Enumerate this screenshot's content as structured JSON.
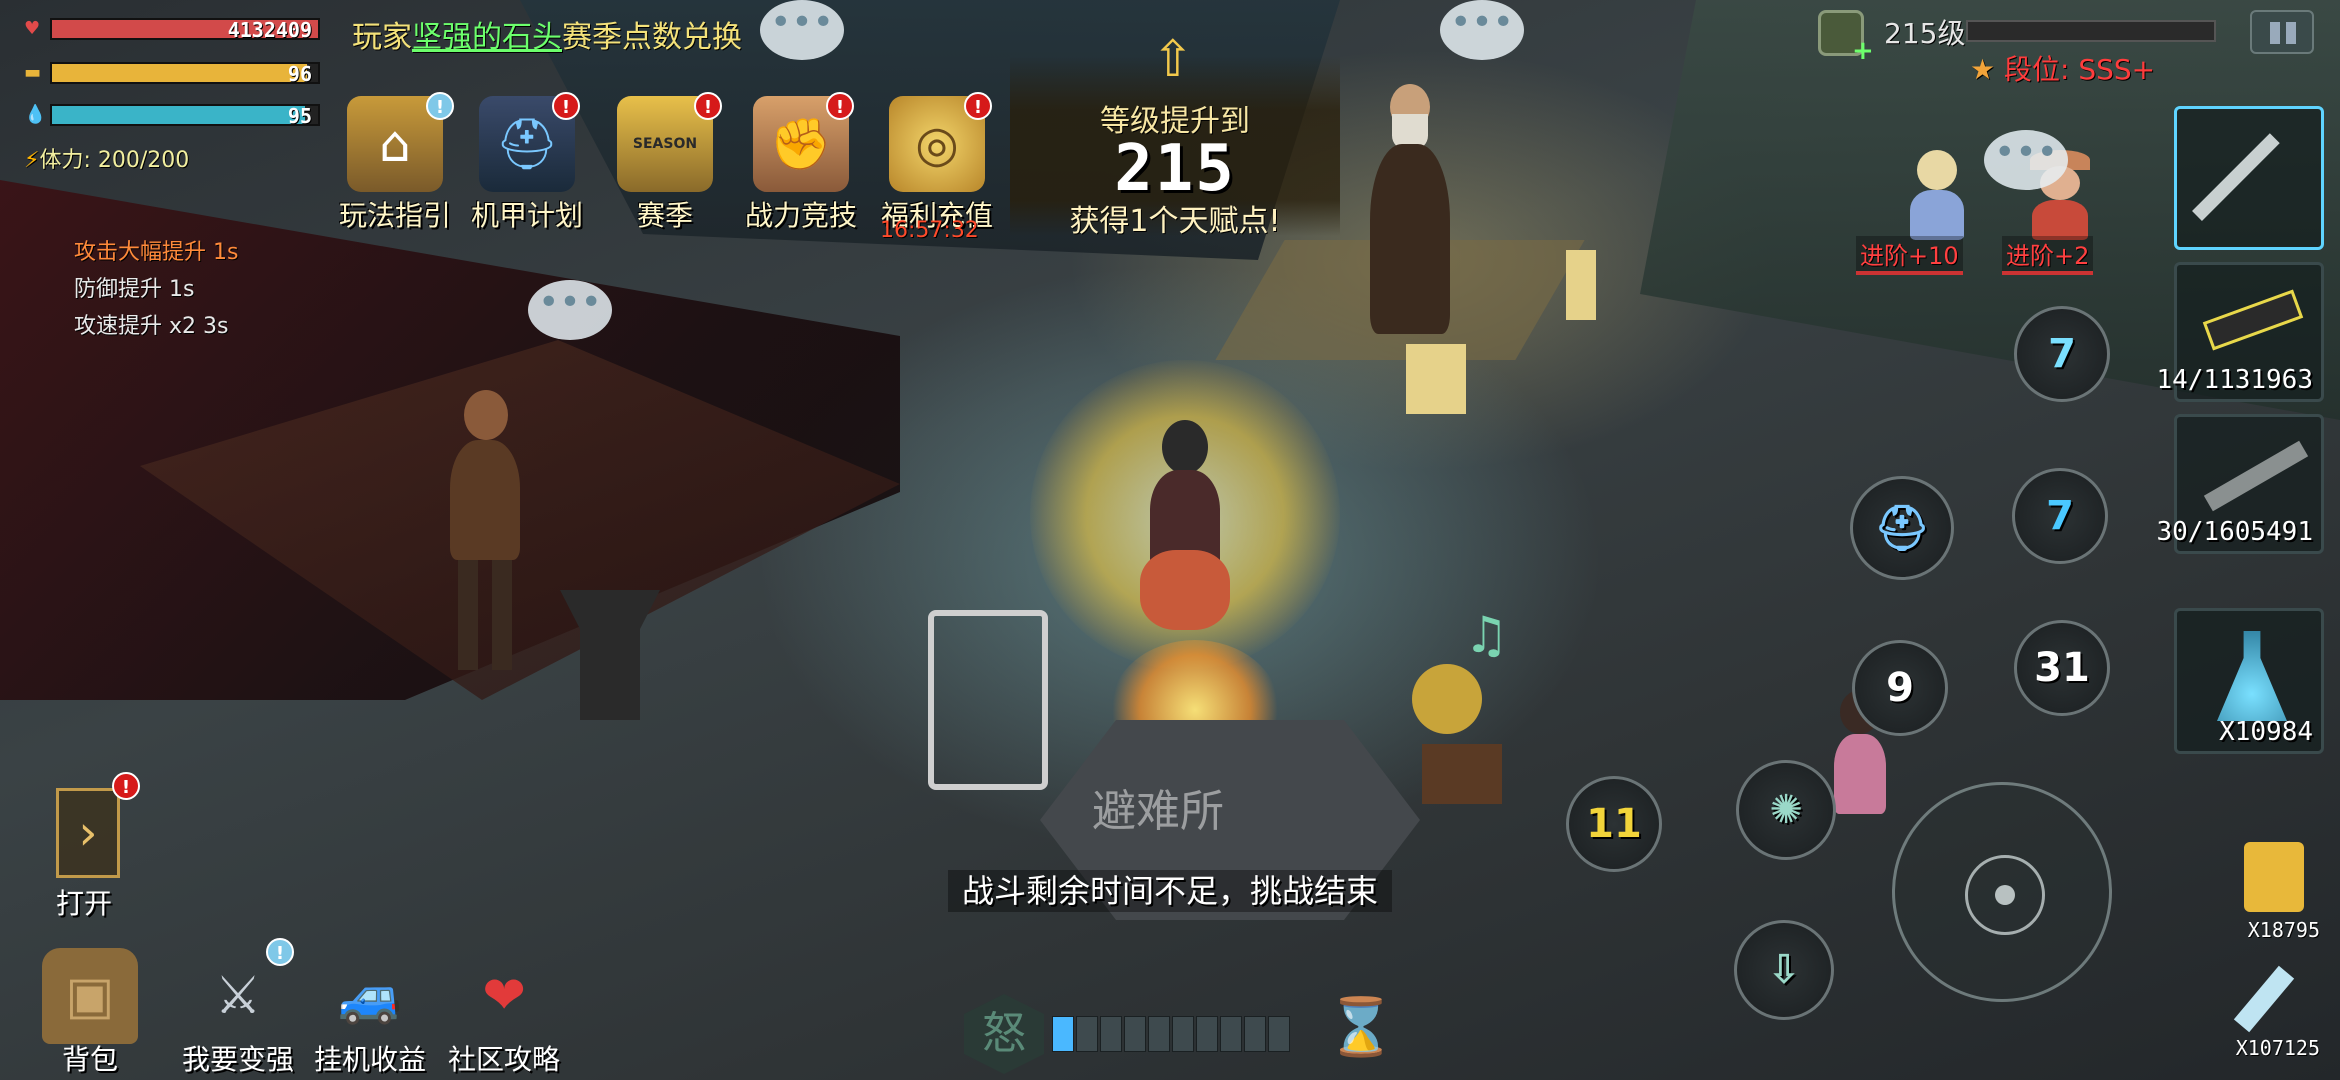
{
  "player_stats": {
    "hp": "4132409",
    "food": "96",
    "water": "95",
    "stamina": "体力: 200/200"
  },
  "buffs": [
    "攻击大幅提升 1s",
    "防御提升 1s",
    "攻速提升 x2 3s"
  ],
  "marquee": {
    "prefix": "玩家",
    "player": "坚强的石头",
    "suffix": "赛季点数兑换"
  },
  "top_menu": [
    {
      "label": "玩法指引",
      "icon": "guide-hut-icon",
      "badge": "!"
    },
    {
      "label": "机甲计划",
      "icon": "mech-helmet-icon",
      "badge": "!"
    },
    {
      "label": "赛季",
      "icon": "season-badge-icon",
      "badge": "!"
    },
    {
      "label": "战力竞技",
      "icon": "fist-icon",
      "badge": "!"
    },
    {
      "label": "福利充值",
      "icon": "coin-stack-icon",
      "badge": "!"
    }
  ],
  "season_badge_text": "SEASON",
  "recharge_timer": "16:57:32",
  "level_up": {
    "title": "等级提升到",
    "level": "215",
    "subtitle": "获得1个天赋点!"
  },
  "top_right": {
    "level": "215级",
    "rank": "段位: SSS+",
    "xp_fraction": 0.0
  },
  "equipment": [
    {
      "name": "machete",
      "qty": ""
    },
    {
      "name": "heavy-gun",
      "qty": "14/1131963"
    },
    {
      "name": "rifle",
      "qty": "30/1605491"
    },
    {
      "name": "potion",
      "qty": "X10984"
    }
  ],
  "consumables": [
    {
      "name": "chips",
      "qty": "X18795"
    },
    {
      "name": "water-bottle",
      "qty": "X107125"
    }
  ],
  "npc_tags": [
    "进阶+10",
    "进阶+2"
  ],
  "skills": [
    {
      "name": "skill-dash",
      "value": "7"
    },
    {
      "name": "skill-mech",
      "value": ""
    },
    {
      "name": "skill-blue",
      "value": "7"
    },
    {
      "name": "skill-claw",
      "value": "9"
    },
    {
      "name": "skill-shield",
      "value": "31"
    },
    {
      "name": "skill-shield-yellow",
      "value": "11"
    },
    {
      "name": "skill-lotus",
      "value": ""
    },
    {
      "name": "skill-lotus-down",
      "value": ""
    }
  ],
  "bottom_menu": [
    {
      "label": "背包",
      "icon": "backpack-icon"
    },
    {
      "label": "我要变强",
      "icon": "sword-upgrade-icon",
      "badge": "!"
    },
    {
      "label": "挂机收益",
      "icon": "car-icon"
    },
    {
      "label": "社区攻略",
      "icon": "heart-hand-icon"
    }
  ],
  "open_button": "打开",
  "battle_message": "战斗剩余时间不足，挑战结束",
  "floor_sign": "避难所",
  "rage_icon": "怒",
  "colors": {
    "hp": "#d24a4a",
    "food": "#e8b43a",
    "water": "#3ab4c8",
    "rank": "#ff3c3c",
    "accent": "#5fd4ff"
  }
}
